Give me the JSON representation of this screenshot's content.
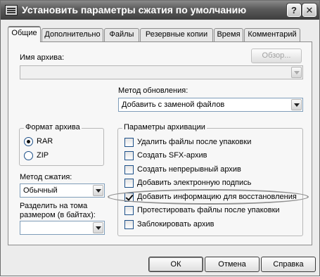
{
  "window": {
    "title": "Установить параметры сжатия по умолчанию",
    "help_button": "?",
    "close_button": "✕"
  },
  "tabs": [
    {
      "label": "Общие",
      "active": true
    },
    {
      "label": "Дополнительно"
    },
    {
      "label": "Файлы"
    },
    {
      "label": "Резервные копии"
    },
    {
      "label": "Время"
    },
    {
      "label": "Комментарий"
    }
  ],
  "general": {
    "archive_name_label": "Имя архива:",
    "archive_name_value": "",
    "browse_button": "Обзор...",
    "update_method_label": "Метод обновления:",
    "update_method_value": "Добавить с заменой файлов",
    "archive_format": {
      "caption": "Формат архива",
      "options": [
        "RAR",
        "ZIP"
      ],
      "selected": "RAR"
    },
    "compression_method_label": "Метод сжатия:",
    "compression_method_value": "Обычный",
    "split_label_line1": "Разделить на тома",
    "split_label_line2": "размером (в байтах):",
    "split_value": "",
    "archiving_options": {
      "caption": "Параметры архивации",
      "items": [
        {
          "label": "Удалить файлы после упаковки",
          "checked": false
        },
        {
          "label": "Создать SFX-архив",
          "checked": false
        },
        {
          "label": "Создать непрерывный архив",
          "checked": false
        },
        {
          "label": "Добавить электронную подпись",
          "checked": false
        },
        {
          "label": "Добавить информацию для восстановления",
          "checked": true
        },
        {
          "label": "Протестировать файлы после упаковки",
          "checked": false
        },
        {
          "label": "Заблокировать архив",
          "checked": false
        }
      ]
    }
  },
  "buttons": {
    "ok": "ОК",
    "cancel": "Отмена",
    "help": "Справка"
  },
  "colors": {
    "titlebar": "#4a4a4a",
    "panel": "#f7f7f7",
    "window": "#ececec",
    "input_border": "#7f9db9"
  }
}
